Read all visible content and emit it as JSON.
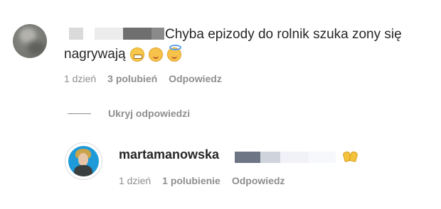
{
  "comment": {
    "text_line1": "Chyba epizody do rolnik szuka zony się",
    "text_line2": "nagrywają",
    "emojis": [
      "grimacing-face-emoji",
      "smiling-face-emoji",
      "halo-face-emoji"
    ],
    "meta": {
      "time": "1 dzień",
      "likes": "3 polubień",
      "reply": "Odpowiedz"
    }
  },
  "replies_toggle": {
    "label": "Ukryj odpowiedzi"
  },
  "reply": {
    "username": "martamanowska",
    "emojis": [
      "raising-hands-emoji"
    ],
    "meta": {
      "time": "1 dzień",
      "likes": "1 polubienie",
      "reply": "Odpowiedz"
    }
  },
  "colors": {
    "text_primary": "#262626",
    "text_secondary": "#8e8e8e",
    "background": "#ffffff"
  }
}
